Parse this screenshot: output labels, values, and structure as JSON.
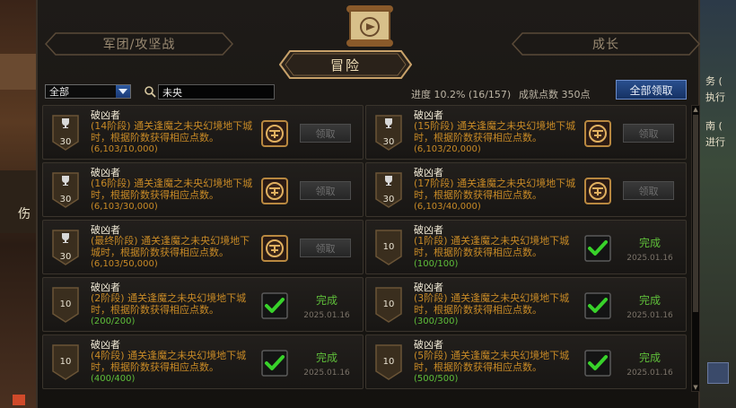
{
  "tabs": {
    "left": "军团/攻坚战",
    "main": "冒险",
    "right": "成长"
  },
  "filter": {
    "value": "全部"
  },
  "search": {
    "value": "未央"
  },
  "stats": {
    "progress": "进度 10.2% (16/157)",
    "points": "成就点数 350点"
  },
  "buttons": {
    "claim_all": "全部领取"
  },
  "right_panel": {
    "line1": "务 (",
    "line2": "执行",
    "line3": "南 (",
    "line4": "进行"
  },
  "left_panel": {
    "glyph": "伤"
  },
  "cards": [
    {
      "title": "破凶者",
      "desc": "(14阶段) 通关逢魔之未央幻境地下城时，根据阶数获得相应点数。",
      "progress": "(6,103/10,000)",
      "badge": "30",
      "status": "claim",
      "button": "领取"
    },
    {
      "title": "破凶者",
      "desc": "(15阶段) 通关逢魔之未央幻境地下城时，根据阶数获得相应点数。",
      "progress": "(6,103/20,000)",
      "badge": "30",
      "status": "claim",
      "button": "领取"
    },
    {
      "title": "破凶者",
      "desc": "(16阶段) 通关逢魔之未央幻境地下城时，根据阶数获得相应点数。",
      "progress": "(6,103/30,000)",
      "badge": "30",
      "status": "claim",
      "button": "领取"
    },
    {
      "title": "破凶者",
      "desc": "(17阶段) 通关逢魔之未央幻境地下城时，根据阶数获得相应点数。",
      "progress": "(6,103/40,000)",
      "badge": "30",
      "status": "claim",
      "button": "领取"
    },
    {
      "title": "破凶者",
      "desc": "(最终阶段) 通关逢魔之未央幻境地下城时，根据阶数获得相应点数。",
      "progress": "(6,103/50,000)",
      "badge": "30",
      "status": "claim",
      "button": "领取"
    },
    {
      "title": "破凶者",
      "desc": "(1阶段) 通关逢魔之未央幻境地下城时，根据阶数获得相应点数。",
      "progress": "(100/100)",
      "badge": "10",
      "status": "done",
      "done_label": "完成",
      "date": "2025.01.16"
    },
    {
      "title": "破凶者",
      "desc": "(2阶段) 通关逢魔之未央幻境地下城时，根据阶数获得相应点数。",
      "progress": "(200/200)",
      "badge": "10",
      "status": "done",
      "done_label": "完成",
      "date": "2025.01.16"
    },
    {
      "title": "破凶者",
      "desc": "(3阶段) 通关逢魔之未央幻境地下城时，根据阶数获得相应点数。",
      "progress": "(300/300)",
      "badge": "10",
      "status": "done",
      "done_label": "完成",
      "date": "2025.01.16"
    },
    {
      "title": "破凶者",
      "desc": "(4阶段) 通关逢魔之未央幻境地下城时，根据阶数获得相应点数。",
      "progress": "(400/400)",
      "badge": "10",
      "status": "done",
      "done_label": "完成",
      "date": "2025.01.16"
    },
    {
      "title": "破凶者",
      "desc": "(5阶段) 通关逢魔之未央幻境地下城时，根据阶数获得相应点数。",
      "progress": "(500/500)",
      "badge": "10",
      "status": "done",
      "done_label": "完成",
      "date": "2025.01.16"
    }
  ]
}
